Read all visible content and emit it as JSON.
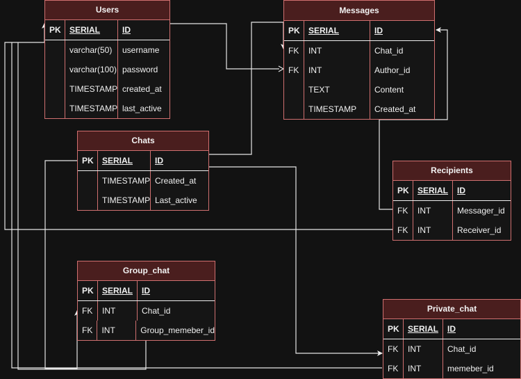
{
  "diagram": {
    "type": "entity-relationship",
    "theme": {
      "background": "#121212",
      "header_fill": "#4a1e1e",
      "border": "#d07070",
      "text": "#f0f0f0",
      "connector": "#e8e8e8"
    },
    "tables": {
      "users": {
        "title": "Users",
        "rows": [
          {
            "key": "PK",
            "type": "SERIAL",
            "name": "ID"
          },
          {
            "key": "",
            "type": "varchar(50)",
            "name": "username"
          },
          {
            "key": "",
            "type": "varchar(100)",
            "name": "password"
          },
          {
            "key": "",
            "type": "TIMESTAMP",
            "name": "created_at"
          },
          {
            "key": "",
            "type": "TIMESTAMP",
            "name": "last_active"
          }
        ]
      },
      "messages": {
        "title": "Messages",
        "rows": [
          {
            "key": "PK",
            "type": "SERIAL",
            "name": "ID"
          },
          {
            "key": "FK",
            "type": "INT",
            "name": "Chat_id"
          },
          {
            "key": "FK",
            "type": "INT",
            "name": "Author_id"
          },
          {
            "key": "",
            "type": "TEXT",
            "name": "Content"
          },
          {
            "key": "",
            "type": "TIMESTAMP",
            "name": "Created_at"
          }
        ]
      },
      "chats": {
        "title": "Chats",
        "rows": [
          {
            "key": "PK",
            "type": "SERIAL",
            "name": "ID"
          },
          {
            "key": "",
            "type": "TIMESTAMP",
            "name": "Created_at"
          },
          {
            "key": "",
            "type": "TIMESTAMP",
            "name": "Last_active"
          }
        ]
      },
      "recipients": {
        "title": "Recipients",
        "rows": [
          {
            "key": "PK",
            "type": "SERIAL",
            "name": "ID"
          },
          {
            "key": "FK",
            "type": "INT",
            "name": "Messager_id"
          },
          {
            "key": "FK",
            "type": "INT",
            "name": "Receiver_id"
          }
        ]
      },
      "group_chat": {
        "title": "Group_chat",
        "rows": [
          {
            "key": "PK",
            "type": "SERIAL",
            "name": "ID"
          },
          {
            "key": "FK",
            "type": "INT",
            "name": "Chat_id"
          },
          {
            "key": "FK",
            "type": "INT",
            "name": "Group_memeber_id"
          }
        ]
      },
      "private_chat": {
        "title": "Private_chat",
        "rows": [
          {
            "key": "PK",
            "type": "SERIAL",
            "name": "ID"
          },
          {
            "key": "FK",
            "type": "INT",
            "name": "Chat_id"
          },
          {
            "key": "FK",
            "type": "INT",
            "name": "memeber_id"
          }
        ]
      }
    },
    "relationships": [
      {
        "from": "Messages.Author_id",
        "to": "Users.ID"
      },
      {
        "from": "Messages.Chat_id",
        "to": "Chats.ID"
      },
      {
        "from": "Recipients.Messager_id",
        "to": "Messages.ID"
      },
      {
        "from": "Recipients.Receiver_id",
        "to": "Users.ID"
      },
      {
        "from": "Group_chat.Chat_id",
        "to": "Chats.ID"
      },
      {
        "from": "Group_chat.Group_memeber_id",
        "to": "Users.ID"
      },
      {
        "from": "Private_chat.Chat_id",
        "to": "Chats.ID"
      },
      {
        "from": "Private_chat.memeber_id",
        "to": "Users.ID"
      }
    ]
  }
}
